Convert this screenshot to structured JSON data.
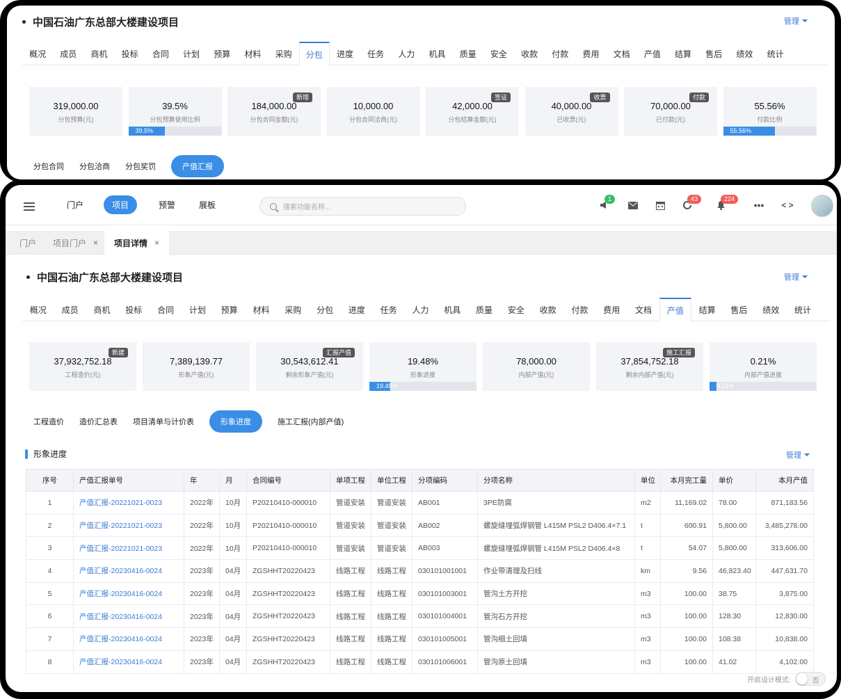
{
  "back": {
    "title": "中国石油广东总部大楼建设项目",
    "manage": "管理",
    "tabs": [
      "概况",
      "成员",
      "商机",
      "投标",
      "合同",
      "计划",
      "预算",
      "材料",
      "采购",
      "分包",
      "进度",
      "任务",
      "人力",
      "机具",
      "质量",
      "安全",
      "收款",
      "付款",
      "费用",
      "文档",
      "产值",
      "结算",
      "售后",
      "绩效",
      "统计"
    ],
    "active_tab": "分包",
    "cards": [
      {
        "value": "319,000.00",
        "label": "分包预算(元)"
      },
      {
        "value": "39.5%",
        "label": "分包预算使用比例",
        "progress": "39.5%"
      },
      {
        "value": "184,000.00",
        "label": "分包合同金额(元)",
        "badge": "新增"
      },
      {
        "value": "10,000.00",
        "label": "分包合同洽商(元)"
      },
      {
        "value": "42,000.00",
        "label": "分包结算金额(元)",
        "badge": "签证"
      },
      {
        "value": "40,000.00",
        "label": "已收票(元)",
        "badge": "收票"
      },
      {
        "value": "70,000.00",
        "label": "已付款(元)",
        "badge": "付款"
      },
      {
        "value": "55.56%",
        "label": "付款比例",
        "progress": "55.56%"
      }
    ],
    "subtabs": [
      "分包合同",
      "分包洽商",
      "分包奖罚",
      "产值汇报"
    ],
    "active_subtab": "产值汇报"
  },
  "topbar": {
    "nav": [
      "门户",
      "项目",
      "预警",
      "展板"
    ],
    "active_nav": "项目",
    "search_placeholder": "搜索功能名称...",
    "badges": {
      "megaphone": "1",
      "refresh": "43",
      "bell": "224"
    },
    "code_label": "< >"
  },
  "pagetabs": {
    "items": [
      "门户",
      "项目门户",
      "项目详情"
    ],
    "close": "×"
  },
  "front": {
    "title": "中国石油广东总部大楼建设项目",
    "manage": "管理",
    "tabs": [
      "概况",
      "成员",
      "商机",
      "投标",
      "合同",
      "计划",
      "预算",
      "材料",
      "采购",
      "分包",
      "进度",
      "任务",
      "人力",
      "机具",
      "质量",
      "安全",
      "收款",
      "付款",
      "费用",
      "文档",
      "产值",
      "结算",
      "售后",
      "绩效",
      "统计"
    ],
    "active_tab": "产值",
    "cards": [
      {
        "value": "37,932,752.18",
        "label": "工程造价(元)",
        "badge": "新建"
      },
      {
        "value": "7,389,139.77",
        "label": "形象产值(元)"
      },
      {
        "value": "30,543,612.41",
        "label": "剩余形象产值(元)",
        "badge": "汇报产值"
      },
      {
        "value": "19.48%",
        "label": "形象进度",
        "progress": "19.48%"
      },
      {
        "value": "78,000.00",
        "label": "内部产值(元)"
      },
      {
        "value": "37,854,752.18",
        "label": "剩余内部产值(元)",
        "badge": "施工汇报"
      },
      {
        "value": "0.21%",
        "label": "内部产值进度",
        "progress": "0.21%"
      }
    ],
    "subtabs": [
      "工程造价",
      "造价汇总表",
      "项目清单与计价表",
      "形象进度",
      "施工汇报(内部产值)"
    ],
    "active_subtab": "形象进度",
    "section_title": "形象进度",
    "section_manage": "管理",
    "table": {
      "headers": [
        "序号",
        "产值汇报单号",
        "年",
        "月",
        "合同编号",
        "单项工程",
        "单位工程",
        "分项编码",
        "分项名称",
        "单位",
        "本月完工量",
        "单价",
        "本月产值"
      ],
      "rows": [
        [
          "1",
          "产值汇报-20221021-0023",
          "2022年",
          "10月",
          "P20210410-000010",
          "管道安装",
          "管道安装",
          "AB001",
          "3PE防腐",
          "m2",
          "11,169.02",
          "78.00",
          "871,183.56"
        ],
        [
          "2",
          "产值汇报-20221021-0023",
          "2022年",
          "10月",
          "P20210410-000010",
          "管道安装",
          "管道安装",
          "AB002",
          "螺旋缝埋弧焊钢管 L415M PSL2 D406.4×7.1",
          "t",
          "600.91",
          "5,800.00",
          "3,485,278.00"
        ],
        [
          "3",
          "产值汇报-20221021-0023",
          "2022年",
          "10月",
          "P20210410-000010",
          "管道安装",
          "管道安装",
          "AB003",
          "螺旋缝埋弧焊钢管 L415M PSL2 D406.4×8",
          "t",
          "54.07",
          "5,800.00",
          "313,606.00"
        ],
        [
          "4",
          "产值汇报-20230416-0024",
          "2023年",
          "04月",
          "ZGSHHT20220423",
          "线路工程",
          "线路工程",
          "030101001001",
          "作业带清理及扫线",
          "km",
          "9.56",
          "46,823.40",
          "447,631.70"
        ],
        [
          "5",
          "产值汇报-20230416-0024",
          "2023年",
          "04月",
          "ZGSHHT20220423",
          "线路工程",
          "线路工程",
          "030101003001",
          "管沟土方开挖",
          "m3",
          "100.00",
          "38.75",
          "3,875.00"
        ],
        [
          "6",
          "产值汇报-20230416-0024",
          "2023年",
          "04月",
          "ZGSHHT20220423",
          "线路工程",
          "线路工程",
          "030101004001",
          "管沟石方开挖",
          "m3",
          "100.00",
          "128.30",
          "12,830.00"
        ],
        [
          "7",
          "产值汇报-20230416-0024",
          "2023年",
          "04月",
          "ZGSHHT20220423",
          "线路工程",
          "线路工程",
          "030101005001",
          "管沟细土回填",
          "m3",
          "100.00",
          "108.38",
          "10,838.00"
        ],
        [
          "8",
          "产值汇报-20230416-0024",
          "2023年",
          "04月",
          "ZGSHHT20220423",
          "线路工程",
          "线路工程",
          "030101006001",
          "管沟原土回填",
          "m3",
          "100.00",
          "41.02",
          "4,102.00"
        ]
      ]
    },
    "design_mode": {
      "label": "开启设计模式:",
      "state": "否"
    }
  },
  "colors": {
    "accent": "#3a8ee6",
    "link": "#3a7bd5",
    "badge_green": "#3cba6e",
    "badge_red": "#f25c5c"
  }
}
